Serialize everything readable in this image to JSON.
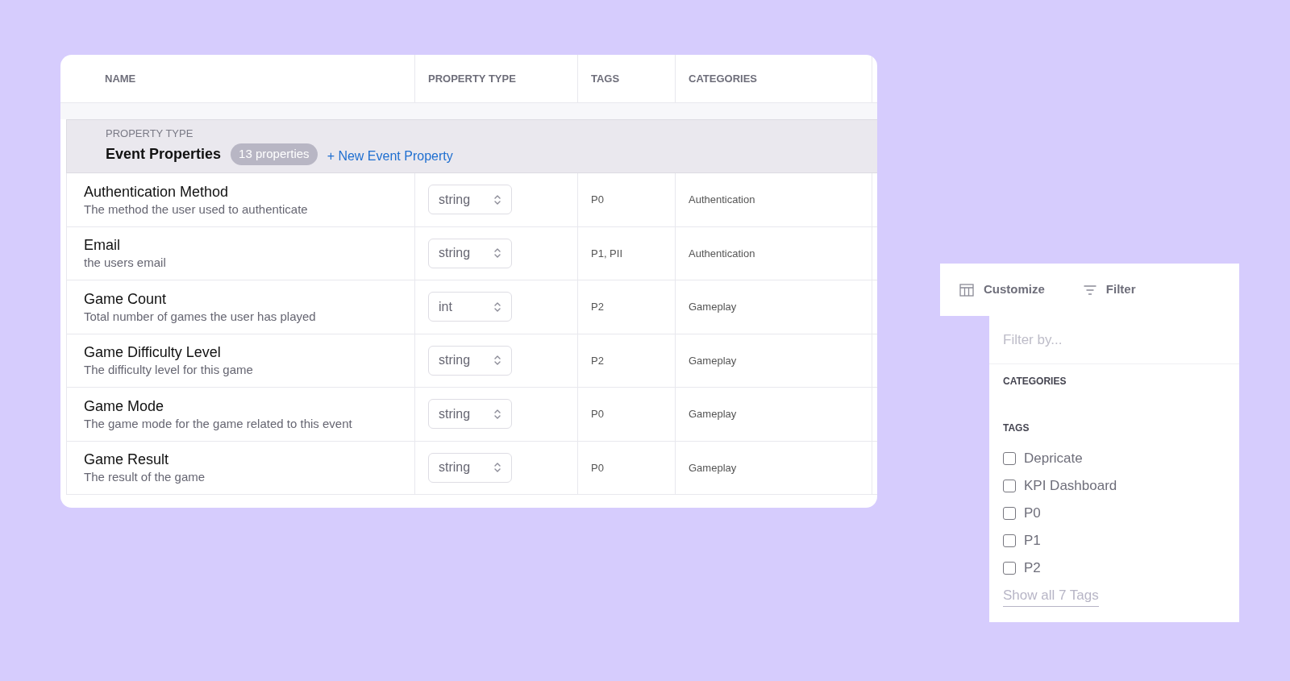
{
  "table": {
    "columns": [
      "NAME",
      "PROPERTY TYPE",
      "TAGS",
      "CATEGORIES"
    ],
    "group": {
      "label": "PROPERTY TYPE",
      "title": "Event Properties",
      "count": "13 properties",
      "action": "+ New Event Property"
    },
    "rows": [
      {
        "name": "Authentication Method",
        "description": "The method the user used to authenticate",
        "type": "string",
        "tags": "P0",
        "category": "Authentication"
      },
      {
        "name": "Email",
        "description": "the users email",
        "type": "string",
        "tags": "P1, PII",
        "category": "Authentication"
      },
      {
        "name": "Game Count",
        "description": "Total number of games the user has played",
        "type": "int",
        "tags": "P2",
        "category": "Gameplay"
      },
      {
        "name": "Game Difficulty Level",
        "description": "The difficulty level for this game",
        "type": "string",
        "tags": "P2",
        "category": "Gameplay"
      },
      {
        "name": "Game Mode",
        "description": "The game mode for the game related to this event",
        "type": "string",
        "tags": "P0",
        "category": "Gameplay"
      },
      {
        "name": "Game Result",
        "description": "The result of the game",
        "type": "string",
        "tags": "P0",
        "category": "Gameplay"
      }
    ]
  },
  "toolbar": {
    "buttons": [
      {
        "kind": "customize",
        "label": "Customize"
      },
      {
        "kind": "filter",
        "label": "Filter"
      }
    ]
  },
  "filter_menu": {
    "search": {
      "placeholder": "Filter by..."
    },
    "sections": [
      {
        "title": "CATEGORIES"
      },
      {
        "title": "TAGS",
        "options": [
          {
            "label": "Depricate",
            "checked": false
          },
          {
            "label": "KPI Dashboard",
            "checked": false
          },
          {
            "label": "P0",
            "checked": false
          },
          {
            "label": "P1",
            "checked": false
          },
          {
            "label": "P2",
            "checked": false
          }
        ],
        "more": "Show all 7 Tags"
      }
    ]
  }
}
